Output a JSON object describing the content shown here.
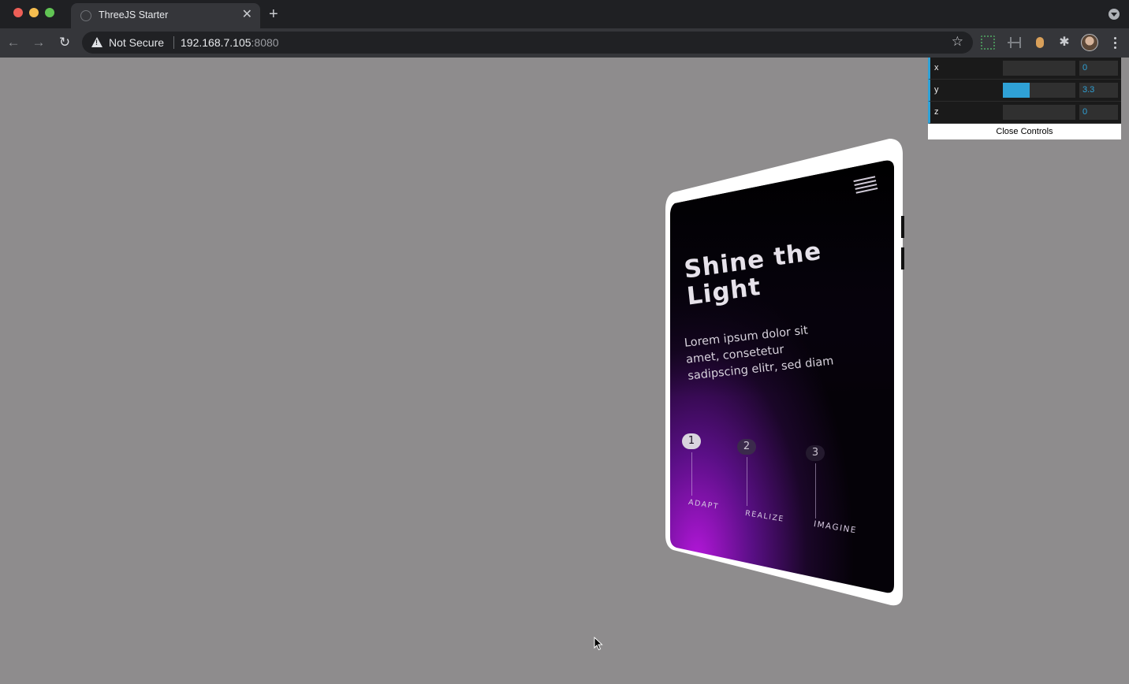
{
  "browser": {
    "tab_title": "ThreeJS Starter",
    "tab_close": "✕",
    "new_tab": "+",
    "security_label": "Not Secure",
    "url_host": "192.168.7.105",
    "url_port": ":8080",
    "icons": [
      "back-arrow-icon",
      "forward-arrow-icon",
      "reload-icon",
      "warning-icon",
      "star-icon",
      "extension-icon",
      "profile-avatar",
      "more-menu-icon"
    ]
  },
  "gui": {
    "accent_color": "#2fa1d6",
    "controls": [
      {
        "label": "x",
        "value": "0",
        "fill_fraction": 0.0
      },
      {
        "label": "y",
        "value": "3.3",
        "fill_fraction": 0.37
      },
      {
        "label": "z",
        "value": "0",
        "fill_fraction": 0.0
      }
    ],
    "close_label": "Close Controls"
  },
  "phone": {
    "headline_line1": "Shine the",
    "headline_line2": "Light",
    "body_line1": "Lorem ipsum dolor sit",
    "body_line2": "amet, consetetur",
    "body_line3": "sadipscing elitr, sed diam",
    "steps": [
      {
        "number": "1",
        "label": "ADAPT"
      },
      {
        "number": "2",
        "label": "REALIZE"
      },
      {
        "number": "3",
        "label": "IMAGINE"
      }
    ],
    "glow_color": "#9b18c9"
  }
}
